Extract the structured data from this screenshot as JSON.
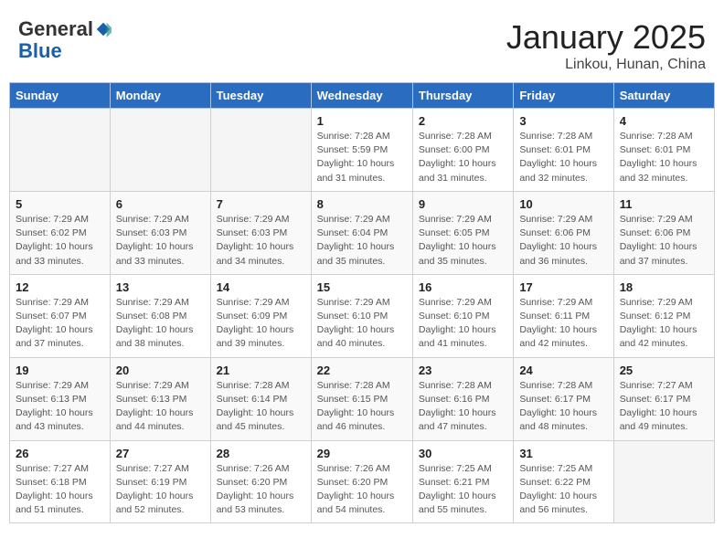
{
  "header": {
    "logo_general": "General",
    "logo_blue": "Blue",
    "cal_title": "January 2025",
    "cal_subtitle": "Linkou, Hunan, China"
  },
  "days_of_week": [
    "Sunday",
    "Monday",
    "Tuesday",
    "Wednesday",
    "Thursday",
    "Friday",
    "Saturday"
  ],
  "weeks": [
    [
      {
        "day": "",
        "info": ""
      },
      {
        "day": "",
        "info": ""
      },
      {
        "day": "",
        "info": ""
      },
      {
        "day": "1",
        "info": "Sunrise: 7:28 AM\nSunset: 5:59 PM\nDaylight: 10 hours\nand 31 minutes."
      },
      {
        "day": "2",
        "info": "Sunrise: 7:28 AM\nSunset: 6:00 PM\nDaylight: 10 hours\nand 31 minutes."
      },
      {
        "day": "3",
        "info": "Sunrise: 7:28 AM\nSunset: 6:01 PM\nDaylight: 10 hours\nand 32 minutes."
      },
      {
        "day": "4",
        "info": "Sunrise: 7:28 AM\nSunset: 6:01 PM\nDaylight: 10 hours\nand 32 minutes."
      }
    ],
    [
      {
        "day": "5",
        "info": "Sunrise: 7:29 AM\nSunset: 6:02 PM\nDaylight: 10 hours\nand 33 minutes."
      },
      {
        "day": "6",
        "info": "Sunrise: 7:29 AM\nSunset: 6:03 PM\nDaylight: 10 hours\nand 33 minutes."
      },
      {
        "day": "7",
        "info": "Sunrise: 7:29 AM\nSunset: 6:03 PM\nDaylight: 10 hours\nand 34 minutes."
      },
      {
        "day": "8",
        "info": "Sunrise: 7:29 AM\nSunset: 6:04 PM\nDaylight: 10 hours\nand 35 minutes."
      },
      {
        "day": "9",
        "info": "Sunrise: 7:29 AM\nSunset: 6:05 PM\nDaylight: 10 hours\nand 35 minutes."
      },
      {
        "day": "10",
        "info": "Sunrise: 7:29 AM\nSunset: 6:06 PM\nDaylight: 10 hours\nand 36 minutes."
      },
      {
        "day": "11",
        "info": "Sunrise: 7:29 AM\nSunset: 6:06 PM\nDaylight: 10 hours\nand 37 minutes."
      }
    ],
    [
      {
        "day": "12",
        "info": "Sunrise: 7:29 AM\nSunset: 6:07 PM\nDaylight: 10 hours\nand 37 minutes."
      },
      {
        "day": "13",
        "info": "Sunrise: 7:29 AM\nSunset: 6:08 PM\nDaylight: 10 hours\nand 38 minutes."
      },
      {
        "day": "14",
        "info": "Sunrise: 7:29 AM\nSunset: 6:09 PM\nDaylight: 10 hours\nand 39 minutes."
      },
      {
        "day": "15",
        "info": "Sunrise: 7:29 AM\nSunset: 6:10 PM\nDaylight: 10 hours\nand 40 minutes."
      },
      {
        "day": "16",
        "info": "Sunrise: 7:29 AM\nSunset: 6:10 PM\nDaylight: 10 hours\nand 41 minutes."
      },
      {
        "day": "17",
        "info": "Sunrise: 7:29 AM\nSunset: 6:11 PM\nDaylight: 10 hours\nand 42 minutes."
      },
      {
        "day": "18",
        "info": "Sunrise: 7:29 AM\nSunset: 6:12 PM\nDaylight: 10 hours\nand 42 minutes."
      }
    ],
    [
      {
        "day": "19",
        "info": "Sunrise: 7:29 AM\nSunset: 6:13 PM\nDaylight: 10 hours\nand 43 minutes."
      },
      {
        "day": "20",
        "info": "Sunrise: 7:29 AM\nSunset: 6:13 PM\nDaylight: 10 hours\nand 44 minutes."
      },
      {
        "day": "21",
        "info": "Sunrise: 7:28 AM\nSunset: 6:14 PM\nDaylight: 10 hours\nand 45 minutes."
      },
      {
        "day": "22",
        "info": "Sunrise: 7:28 AM\nSunset: 6:15 PM\nDaylight: 10 hours\nand 46 minutes."
      },
      {
        "day": "23",
        "info": "Sunrise: 7:28 AM\nSunset: 6:16 PM\nDaylight: 10 hours\nand 47 minutes."
      },
      {
        "day": "24",
        "info": "Sunrise: 7:28 AM\nSunset: 6:17 PM\nDaylight: 10 hours\nand 48 minutes."
      },
      {
        "day": "25",
        "info": "Sunrise: 7:27 AM\nSunset: 6:17 PM\nDaylight: 10 hours\nand 49 minutes."
      }
    ],
    [
      {
        "day": "26",
        "info": "Sunrise: 7:27 AM\nSunset: 6:18 PM\nDaylight: 10 hours\nand 51 minutes."
      },
      {
        "day": "27",
        "info": "Sunrise: 7:27 AM\nSunset: 6:19 PM\nDaylight: 10 hours\nand 52 minutes."
      },
      {
        "day": "28",
        "info": "Sunrise: 7:26 AM\nSunset: 6:20 PM\nDaylight: 10 hours\nand 53 minutes."
      },
      {
        "day": "29",
        "info": "Sunrise: 7:26 AM\nSunset: 6:20 PM\nDaylight: 10 hours\nand 54 minutes."
      },
      {
        "day": "30",
        "info": "Sunrise: 7:25 AM\nSunset: 6:21 PM\nDaylight: 10 hours\nand 55 minutes."
      },
      {
        "day": "31",
        "info": "Sunrise: 7:25 AM\nSunset: 6:22 PM\nDaylight: 10 hours\nand 56 minutes."
      },
      {
        "day": "",
        "info": ""
      }
    ]
  ]
}
